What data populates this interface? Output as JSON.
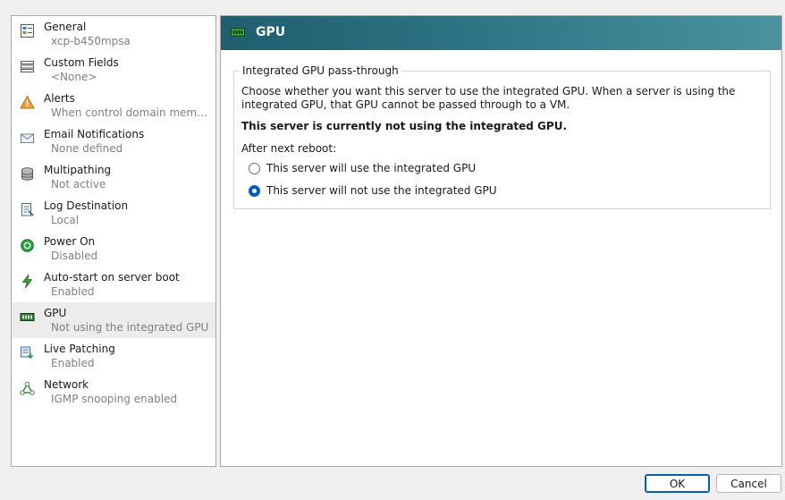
{
  "sidebar": {
    "items": [
      {
        "title": "General",
        "subtitle": "xcp-b450mpsa",
        "icon": "general-properties-icon"
      },
      {
        "title": "Custom Fields",
        "subtitle": "<None>",
        "icon": "custom-fields-icon"
      },
      {
        "title": "Alerts",
        "subtitle": "When control domain memory ...",
        "icon": "alert-warning-icon"
      },
      {
        "title": "Email Notifications",
        "subtitle": "None defined",
        "icon": "email-icon"
      },
      {
        "title": "Multipathing",
        "subtitle": "Not active",
        "icon": "storage-disk-icon"
      },
      {
        "title": "Log Destination",
        "subtitle": "Local",
        "icon": "log-document-icon"
      },
      {
        "title": "Power On",
        "subtitle": "Disabled",
        "icon": "power-on-icon"
      },
      {
        "title": "Auto-start on server boot",
        "subtitle": "Enabled",
        "icon": "lightning-icon"
      },
      {
        "title": "GPU",
        "subtitle": "Not using the integrated GPU",
        "icon": "gpu-card-icon"
      },
      {
        "title": "Live Patching",
        "subtitle": "Enabled",
        "icon": "live-patching-icon"
      },
      {
        "title": "Network",
        "subtitle": "IGMP snooping enabled",
        "icon": "network-icon"
      }
    ],
    "selected_index": 8
  },
  "panel": {
    "header_title": "GPU",
    "header_icon": "gpu-card-icon",
    "group_title": "Integrated GPU pass-through",
    "description": "Choose whether you want this server to use the integrated GPU. When a server is using the integrated GPU, that GPU cannot be passed through to a VM.",
    "status": "This server is currently not using the integrated GPU.",
    "after_reboot_label": "After next reboot:",
    "options": [
      {
        "label": "This server will use the integrated GPU",
        "checked": false
      },
      {
        "label": "This server will not use the integrated GPU",
        "checked": true
      }
    ]
  },
  "buttons": {
    "ok": "OK",
    "cancel": "Cancel"
  },
  "colors": {
    "header_gradient_start": "#1f5e6e",
    "header_gradient_end": "#4b92a0",
    "accent": "#005fb8",
    "selected_row": "#ececec"
  }
}
